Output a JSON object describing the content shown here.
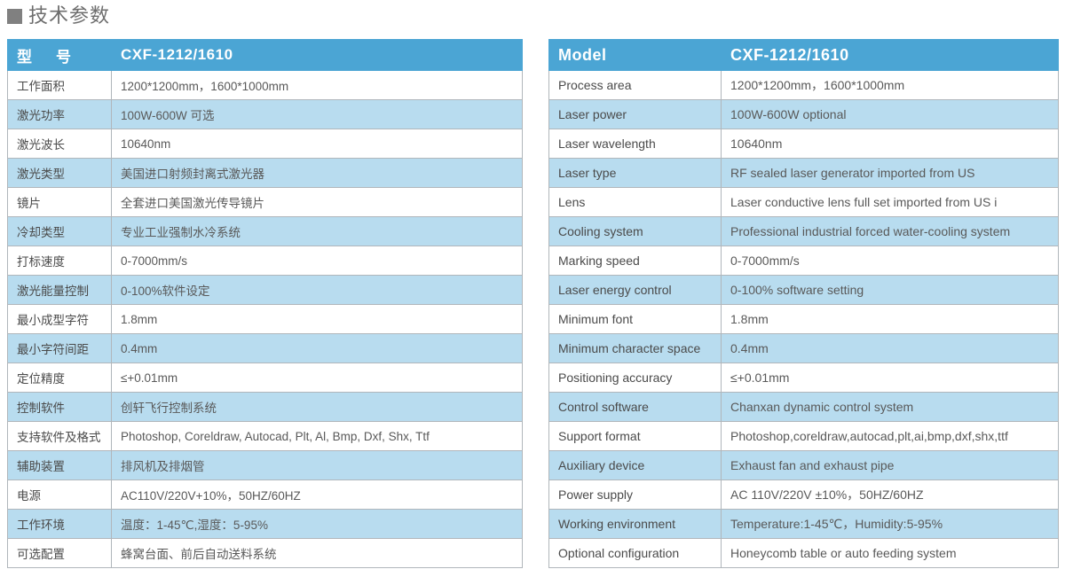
{
  "section": {
    "marker_icon": "square-bullet-icon",
    "title": "技术参数",
    "marker_color": "#808080",
    "title_color": "#6e6e6e"
  },
  "colors": {
    "header_bg": "#4ba5d4",
    "header_text": "#ffffff",
    "row_alt_bg": "#b8dcef",
    "row_bg": "#ffffff",
    "border": "#b0b6bb",
    "body_text": "#595959"
  },
  "table_cn": {
    "header": {
      "key": "型　号",
      "value": "CXF-1212/1610"
    },
    "rows": [
      {
        "key": "工作面积",
        "value": "1200*1200mm，1600*1000mm"
      },
      {
        "key": "激光功率",
        "value": "100W-600W 可选"
      },
      {
        "key": "激光波长",
        "value": "10640nm"
      },
      {
        "key": "激光类型",
        "value": "美国进口射频封离式激光器"
      },
      {
        "key": "镜片",
        "value": "全套进口美国激光传导镜片"
      },
      {
        "key": "冷却类型",
        "value": "专业工业强制水冷系统"
      },
      {
        "key": "打标速度",
        "value": "0-7000mm/s"
      },
      {
        "key": "激光能量控制",
        "value": "0-100%软件设定"
      },
      {
        "key": "最小成型字符",
        "value": "1.8mm"
      },
      {
        "key": "最小字符间距",
        "value": "0.4mm"
      },
      {
        "key": "定位精度",
        "value": "≤+0.01mm"
      },
      {
        "key": "控制软件",
        "value": "创轩飞行控制系统"
      },
      {
        "key": "支持软件及格式",
        "value": "Photoshop, Coreldraw, Autocad, Plt, Al, Bmp, Dxf, Shx, Ttf"
      },
      {
        "key": "辅助装置",
        "value": "排风机及排烟管"
      },
      {
        "key": "电源",
        "value": "AC110V/220V+10%，50HZ/60HZ"
      },
      {
        "key": "工作环境",
        "value": "温度：1-45℃,湿度：5-95%"
      },
      {
        "key": "可选配置",
        "value": "蜂窝台面、前后自动送料系统"
      }
    ]
  },
  "table_en": {
    "header": {
      "key": "Model",
      "value": "CXF-1212/1610"
    },
    "rows": [
      {
        "key": "Process area",
        "value": "1200*1200mm，1600*1000mm"
      },
      {
        "key": "Laser power",
        "value": "100W-600W optional"
      },
      {
        "key": "Laser wavelength",
        "value": "10640nm"
      },
      {
        "key": "Laser type",
        "value": "RF sealed laser generator imported from US"
      },
      {
        "key": "Lens",
        "value": "Laser conductive lens full set imported from US i"
      },
      {
        "key": "Cooling system",
        "value": "Professional industrial forced water-cooling system"
      },
      {
        "key": "Marking speed",
        "value": "0-7000mm/s"
      },
      {
        "key": "Laser energy control",
        "value": "0-100% software setting"
      },
      {
        "key": "Minimum  font",
        "value": "1.8mm"
      },
      {
        "key": "Minimum character space",
        "value": "0.4mm"
      },
      {
        "key": "Positioning accuracy",
        "value": "≤+0.01mm"
      },
      {
        "key": "Control software",
        "value": "Chanxan dynamic control system"
      },
      {
        "key": "Support format",
        "value": "Photoshop,coreldraw,autocad,plt,ai,bmp,dxf,shx,ttf"
      },
      {
        "key": "Auxiliary device",
        "value": "Exhaust fan and exhaust pipe"
      },
      {
        "key": "Power supply",
        "value": "AC 110V/220V ±10%，50HZ/60HZ"
      },
      {
        "key": "Working environment",
        "value": "Temperature:1-45℃，Humidity:5-95%"
      },
      {
        "key": "Optional configuration",
        "value": "Honeycomb table or auto feeding system"
      }
    ]
  }
}
